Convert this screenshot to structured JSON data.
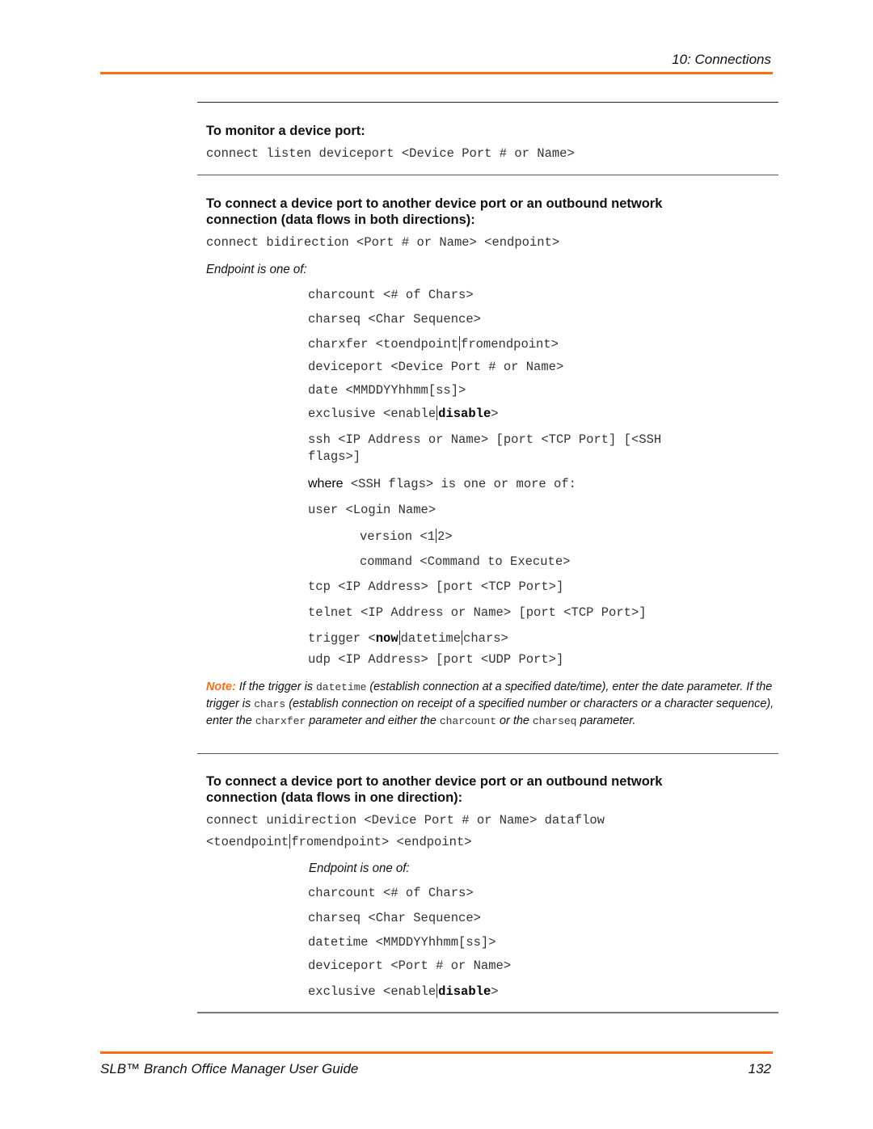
{
  "header": {
    "chapter": "10: Connections"
  },
  "footer": {
    "title": "SLB™ Branch Office Manager User Guide",
    "page_number": "132"
  },
  "colors": {
    "accent": "#ff6a13"
  },
  "section_monitor": {
    "heading": "To monitor a device port:",
    "command": "connect listen deviceport <Device Port # or Name>"
  },
  "section_bidirection": {
    "heading_line1": "To connect a device port to another device port or an outbound network",
    "heading_line2": "connection (data flows in both directions):",
    "command": "connect bidirection <Port # or Name> <endpoint>",
    "endpoint_intro": "Endpoint is one of:",
    "endpoints": {
      "charcount": "charcount <# of Chars>",
      "charseq": "charseq <Char Sequence>",
      "charxfer_a": "charxfer <toendpoint",
      "charxfer_b": "fromendpoint>",
      "deviceport": "deviceport <Device Port # or Name>",
      "date": "date <MMDDYYhhmm[ss]>",
      "exclusive_a": "exclusive <enable",
      "exclusive_b": "disable",
      "exclusive_c": ">",
      "ssh_line1": "ssh <IP Address or Name> [port <TCP Port] [<SSH",
      "ssh_line2": "flags>]",
      "where_word": "where",
      "where_rest": " <SSH flags> is one or more of:",
      "user": "user <Login Name>",
      "version_a": "version <1",
      "version_b": "2>",
      "command": "command <Command to Execute>",
      "tcp": "tcp <IP Address> [port <TCP Port>]",
      "telnet": "telnet <IP Address or Name> [port <TCP Port>]",
      "trigger_a": "trigger <",
      "trigger_b": "now",
      "trigger_c": "datetime",
      "trigger_d": "chars>",
      "udp": "udp <IP Address> [port <UDP Port>]"
    }
  },
  "note": {
    "label": "Note:",
    "t1": " If the trigger is ",
    "c1": "datetime",
    "t2": " (establish connection at a specified date/time), enter the date parameter. If the trigger is ",
    "c2": "chars",
    "t3": " (establish connection on receipt of a specified number or characters or a character sequence), enter the ",
    "c3": "charxfer",
    "t4": " parameter and either the ",
    "c4": "charcount",
    "t5": " or the ",
    "c5": "charseq",
    "t6": "  parameter."
  },
  "section_unidirection": {
    "heading_line1": "To connect a device port to another device port or an outbound network",
    "heading_line2": "connection (data flows in one direction):",
    "command_line1": "connect unidirection <Device Port # or Name> dataflow",
    "command_line2_a": "<toendpoint",
    "command_line2_b": "fromendpoint> <endpoint>",
    "endpoint_intro": "Endpoint is one of:",
    "endpoints": {
      "charcount": "charcount <# of Chars>",
      "charseq": "charseq <Char Sequence>",
      "datetime": "datetime <MMDDYYhhmm[ss]>",
      "deviceport": "deviceport <Port # or Name>",
      "exclusive_a": "exclusive <enable",
      "exclusive_b": "disable",
      "exclusive_c": ">"
    }
  }
}
